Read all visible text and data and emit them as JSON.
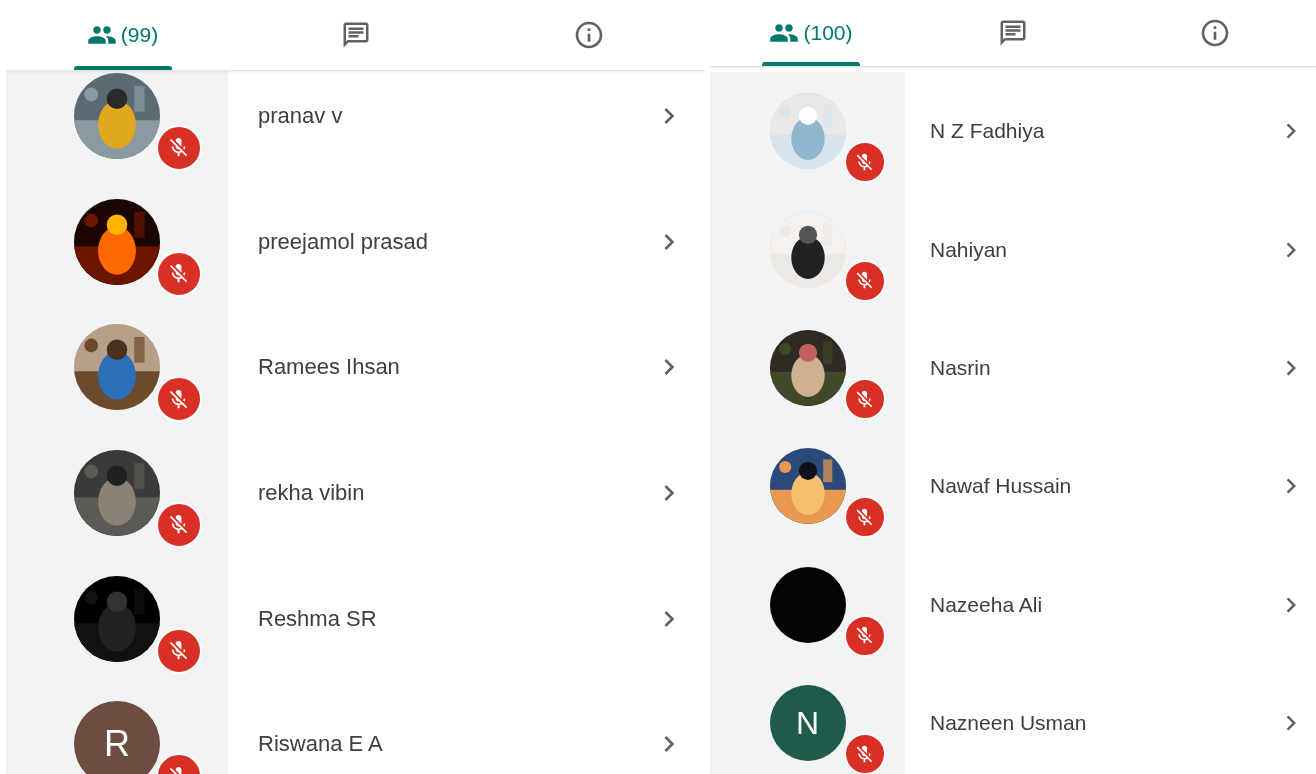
{
  "panels": [
    {
      "tabs": [
        {
          "kind": "people",
          "label": "(99)",
          "selected": true
        },
        {
          "kind": "chat",
          "selected": false
        },
        {
          "kind": "info",
          "selected": false
        }
      ],
      "participants": [
        {
          "name": "pranav v",
          "muted": true
        },
        {
          "name": "preejamol prasad",
          "muted": true
        },
        {
          "name": "Ramees Ihsan",
          "muted": true
        },
        {
          "name": "rekha vibin",
          "muted": true
        },
        {
          "name": "Reshma SR",
          "muted": true
        },
        {
          "name": "Riswana E A",
          "avatar": {
            "kind": "initial",
            "letter": "R",
            "color": "#6d4c41"
          },
          "muted": true
        }
      ]
    },
    {
      "tabs": [
        {
          "kind": "people",
          "label": "(100)",
          "selected": true
        },
        {
          "kind": "chat",
          "selected": false
        },
        {
          "kind": "info",
          "selected": false
        }
      ],
      "participants": [
        {
          "name": "N Z Fadhiya",
          "muted": true
        },
        {
          "name": "Nahiyan",
          "muted": true
        },
        {
          "name": "Nasrin",
          "muted": true
        },
        {
          "name": "Nawaf Hussain",
          "muted": true
        },
        {
          "name": "Nazeeha Ali",
          "avatar": {
            "kind": "plain",
            "color": "#050505"
          },
          "muted": true
        },
        {
          "name": "Nazneen Usman",
          "avatar": {
            "kind": "initial",
            "letter": "N",
            "color": "#1e5b4a"
          },
          "muted": true
        }
      ]
    }
  ]
}
